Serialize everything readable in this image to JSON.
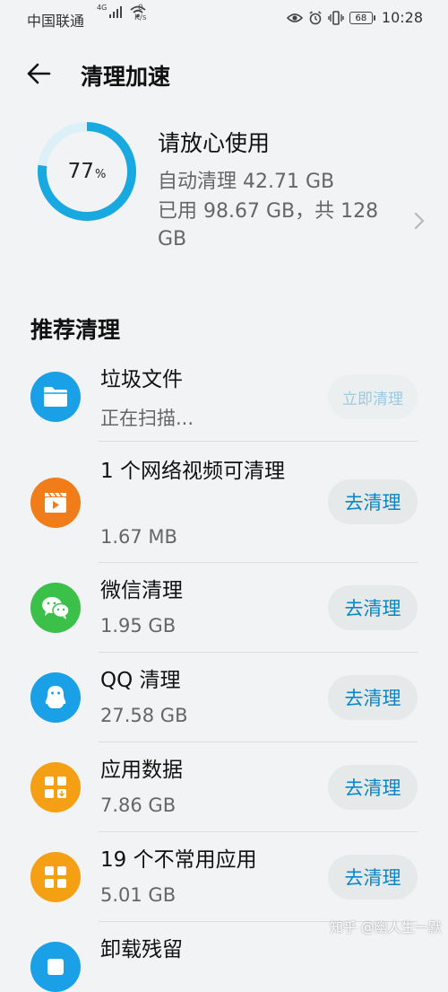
{
  "status_bar": {
    "carrier": "中国联通",
    "net_type": "4G",
    "speed_value": "0",
    "speed_unit": "K/s",
    "battery": "68",
    "time": "10:28"
  },
  "header": {
    "title": "清理加速"
  },
  "summary": {
    "percent": "77",
    "percent_unit": "%",
    "percent_value": 0.77,
    "status": "请放心使用",
    "auto_clean": "自动清理 42.71 GB",
    "usage": "已用 98.67 GB，共 128 GB",
    "ring_color": "#17a9df",
    "ring_track_color": "#dcf0f8"
  },
  "section": {
    "title": "推荐清理"
  },
  "items": [
    {
      "name": "垃圾文件",
      "sub": "正在扫描...",
      "button": "立即清理",
      "icon": "folder-icon",
      "color": "#1aa0e6"
    },
    {
      "name": "1 个网络视频可清理",
      "sub": "1.67 MB",
      "button": "去清理",
      "icon": "video-clapper-icon",
      "color": "#f07c1a"
    },
    {
      "name": "微信清理",
      "sub": "1.95 GB",
      "button": "去清理",
      "icon": "wechat-icon",
      "color": "#3bc14a"
    },
    {
      "name": "QQ 清理",
      "sub": "27.58 GB",
      "button": "去清理",
      "icon": "qq-penguin-icon",
      "color": "#1aa0e6"
    },
    {
      "name": "应用数据",
      "sub": "7.86 GB",
      "button": "去清理",
      "icon": "app-data-icon",
      "color": "#f5a014"
    },
    {
      "name": "19 个不常用应用",
      "sub": "5.01 GB",
      "button": "去清理",
      "icon": "app-grid-icon",
      "color": "#f5a014"
    },
    {
      "name": "卸载残留",
      "icon": "uninstall-residue-icon",
      "color": "#1aa0e6"
    }
  ],
  "watermark": "知乎 @幽人生一默"
}
